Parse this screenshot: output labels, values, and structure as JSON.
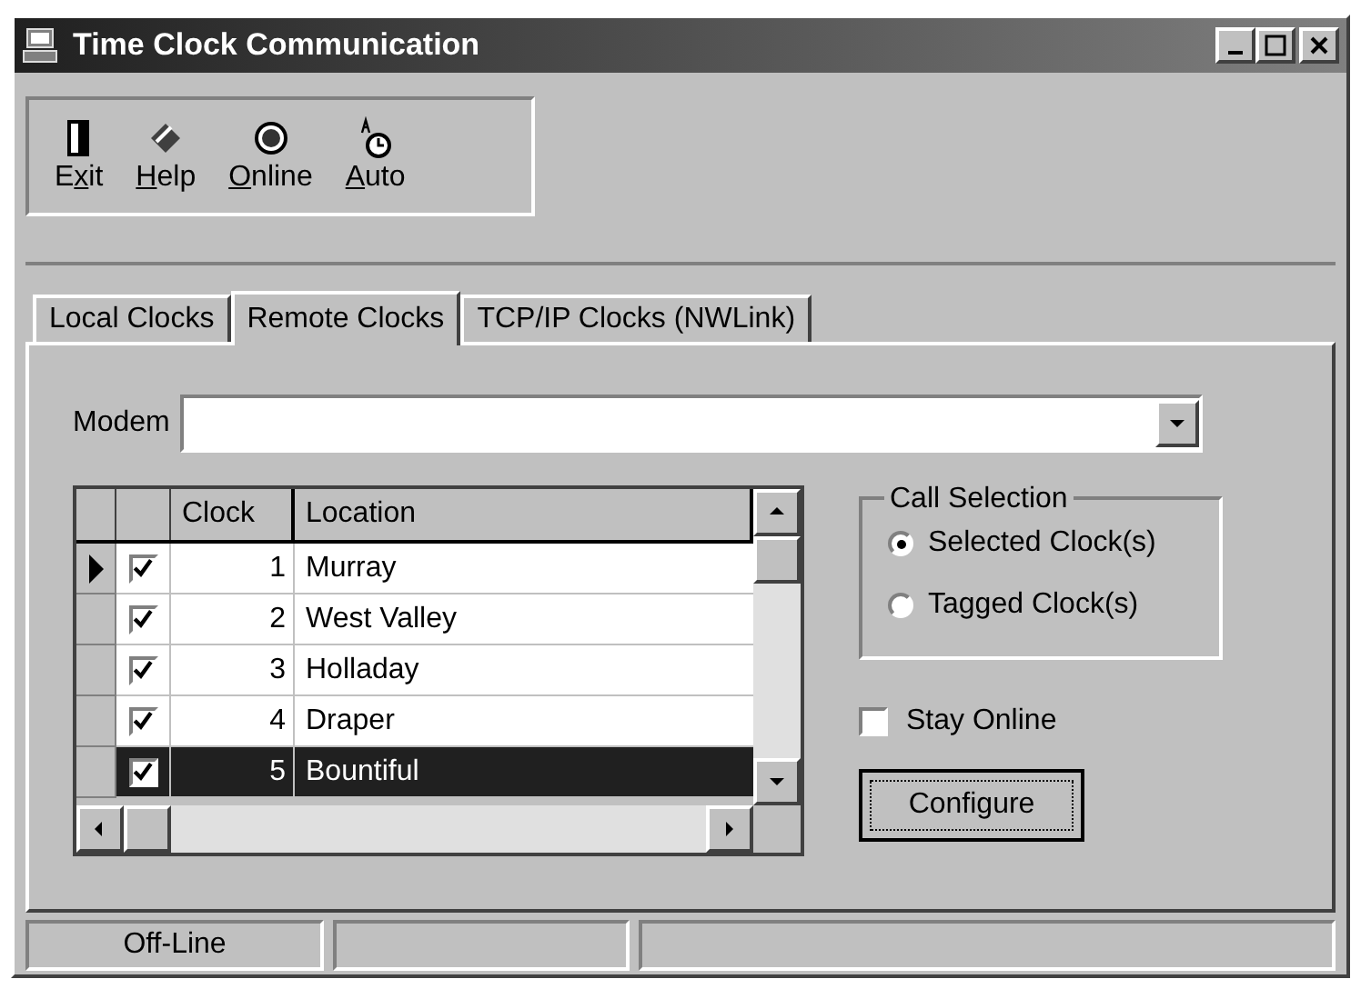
{
  "window": {
    "title": "Time Clock Communication"
  },
  "toolbar": [
    {
      "kind": "exit",
      "pre": "E",
      "key": "x",
      "post": "it"
    },
    {
      "kind": "help",
      "key": "H",
      "post": "elp"
    },
    {
      "kind": "online",
      "key": "O",
      "post": "nline"
    },
    {
      "kind": "auto",
      "key": "A",
      "post": "uto"
    }
  ],
  "tabs": [
    {
      "label": "Local Clocks",
      "selected": false
    },
    {
      "label": "Remote Clocks",
      "selected": true
    },
    {
      "label": "TCP/IP Clocks (NWLink)",
      "selected": false
    }
  ],
  "modem": {
    "label": "Modem"
  },
  "table": {
    "columns": [
      "Clock",
      "Location"
    ],
    "rows": [
      {
        "current": true,
        "checked": true,
        "clock": "1",
        "location": "Murray",
        "selected": false
      },
      {
        "current": false,
        "checked": true,
        "clock": "2",
        "location": "West Valley",
        "selected": false
      },
      {
        "current": false,
        "checked": true,
        "clock": "3",
        "location": "Holladay",
        "selected": false
      },
      {
        "current": false,
        "checked": true,
        "clock": "4",
        "location": "Draper",
        "selected": false
      },
      {
        "current": false,
        "checked": true,
        "clock": "5",
        "location": "Bountiful",
        "selected": true
      }
    ]
  },
  "call_selection": {
    "title": "Call Selection",
    "options": [
      {
        "label": "Selected Clock(s)",
        "selected": true
      },
      {
        "label": "Tagged Clock(s)",
        "selected": false
      }
    ]
  },
  "stay_online": {
    "label": "Stay Online",
    "checked": false
  },
  "configure_button": "Configure",
  "status_bar": [
    "Off-Line"
  ]
}
